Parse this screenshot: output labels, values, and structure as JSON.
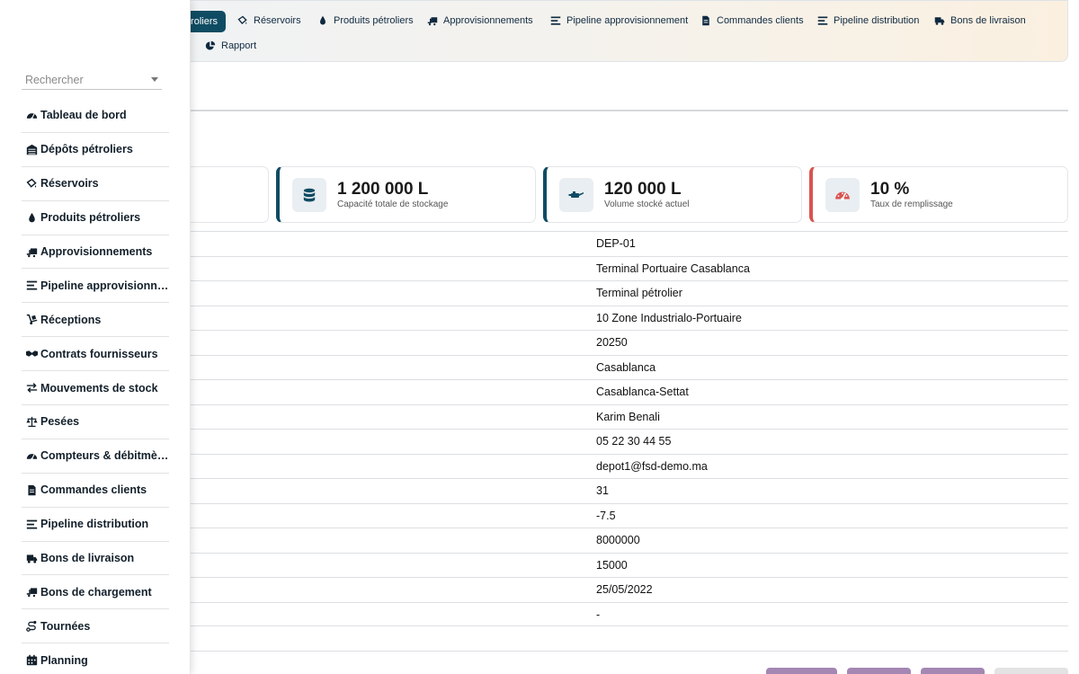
{
  "colors": {
    "accent": "#0f4c63",
    "danger": "#d9534f",
    "purple_button": "#a487b3"
  },
  "topnav": {
    "items": [
      {
        "label": "roliers",
        "icon": "oil-depot-icon",
        "active": true
      },
      {
        "label": "Réservoirs",
        "icon": "tank-icon"
      },
      {
        "label": "Produits pétroliers",
        "icon": "droplet-icon"
      },
      {
        "label": "Approvisionnements",
        "icon": "truck-loading-icon"
      },
      {
        "label": "Pipeline approvisionnement",
        "icon": "bars-icon"
      },
      {
        "label": "Commandes clients",
        "icon": "document-icon"
      },
      {
        "label": "Pipeline distribution",
        "icon": "bars-icon"
      },
      {
        "label": "Bons de livraison",
        "icon": "truck-icon"
      },
      {
        "label": "Rapport",
        "icon": "pie-chart-icon"
      }
    ]
  },
  "kpis": [
    {
      "value": "1 200 000 L",
      "label": "Capacité totale de stockage",
      "icon": "database-icon"
    },
    {
      "value": "120 000 L",
      "label": "Volume stocké actuel",
      "icon": "oil-can-icon"
    },
    {
      "value": "10 %",
      "label": "Taux de remplissage",
      "icon": "gauge-icon"
    }
  ],
  "details": {
    "values": [
      "DEP-01",
      "Terminal Portuaire Casablanca",
      "Terminal pétrolier",
      "10 Zone Industrialo-Portuaire",
      "20250",
      "Casablanca",
      "Casablanca-Settat",
      "Karim Benali",
      "05 22 30 44 55",
      "depot1@fsd-demo.ma",
      "31",
      "-7.5",
      "8000000",
      "15000",
      "25/05/2022",
      "-"
    ]
  },
  "sidebar": {
    "search": {
      "placeholder": "Rechercher"
    },
    "items": [
      {
        "label": "Tableau de bord",
        "icon": "dashboard-icon"
      },
      {
        "label": "Dépôts pétroliers",
        "icon": "oil-depot-icon"
      },
      {
        "label": "Réservoirs",
        "icon": "tank-icon"
      },
      {
        "label": "Produits pétroliers",
        "icon": "droplet-icon"
      },
      {
        "label": "Approvisionnements",
        "icon": "truck-loading-icon"
      },
      {
        "label": "Pipeline approvisionnement",
        "icon": "bars-icon"
      },
      {
        "label": "Réceptions",
        "icon": "dolly-icon"
      },
      {
        "label": "Contrats fournisseurs",
        "icon": "handshake-icon"
      },
      {
        "label": "Mouvements de stock",
        "icon": "exchange-icon"
      },
      {
        "label": "Pesées",
        "icon": "scale-icon"
      },
      {
        "label": "Compteurs & débitmètres",
        "icon": "dashboard-icon"
      },
      {
        "label": "Commandes clients",
        "icon": "document-icon"
      },
      {
        "label": "Pipeline distribution",
        "icon": "bars-icon"
      },
      {
        "label": "Bons de livraison",
        "icon": "truck-icon"
      },
      {
        "label": "Bons de chargement",
        "icon": "truck-loading-icon"
      },
      {
        "label": "Tournées",
        "icon": "route-icon"
      },
      {
        "label": "Planning",
        "icon": "calendar-icon"
      }
    ]
  }
}
